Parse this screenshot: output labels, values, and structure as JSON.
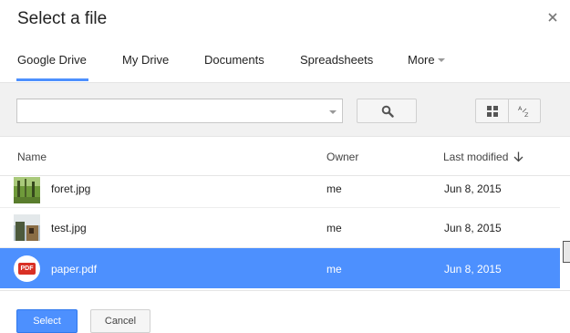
{
  "dialog": {
    "title": "Select a file"
  },
  "tabs": [
    {
      "label": "Google Drive",
      "active": true
    },
    {
      "label": "My Drive",
      "active": false
    },
    {
      "label": "Documents",
      "active": false
    },
    {
      "label": "Spreadsheets",
      "active": false
    },
    {
      "label": "More",
      "active": false
    }
  ],
  "toolbar": {
    "search_value": "",
    "icons": {
      "search": "search-icon",
      "grid": "grid-view-icon",
      "sort": "sort-az-icon"
    }
  },
  "columns": {
    "name": "Name",
    "owner": "Owner",
    "last_modified": "Last modified"
  },
  "files": [
    {
      "name": "foret.jpg",
      "owner": "me",
      "modified": "Jun 8, 2015",
      "type": "image",
      "selected": false
    },
    {
      "name": "test.jpg",
      "owner": "me",
      "modified": "Jun 8, 2015",
      "type": "image",
      "selected": false
    },
    {
      "name": "paper.pdf",
      "owner": "me",
      "modified": "Jun 8, 2015",
      "type": "pdf",
      "selected": true
    }
  ],
  "pdf_badge": "PDF",
  "footer": {
    "select_label": "Select",
    "cancel_label": "Cancel"
  },
  "colors": {
    "accent": "#4d90fe",
    "pdf": "#d93025"
  }
}
